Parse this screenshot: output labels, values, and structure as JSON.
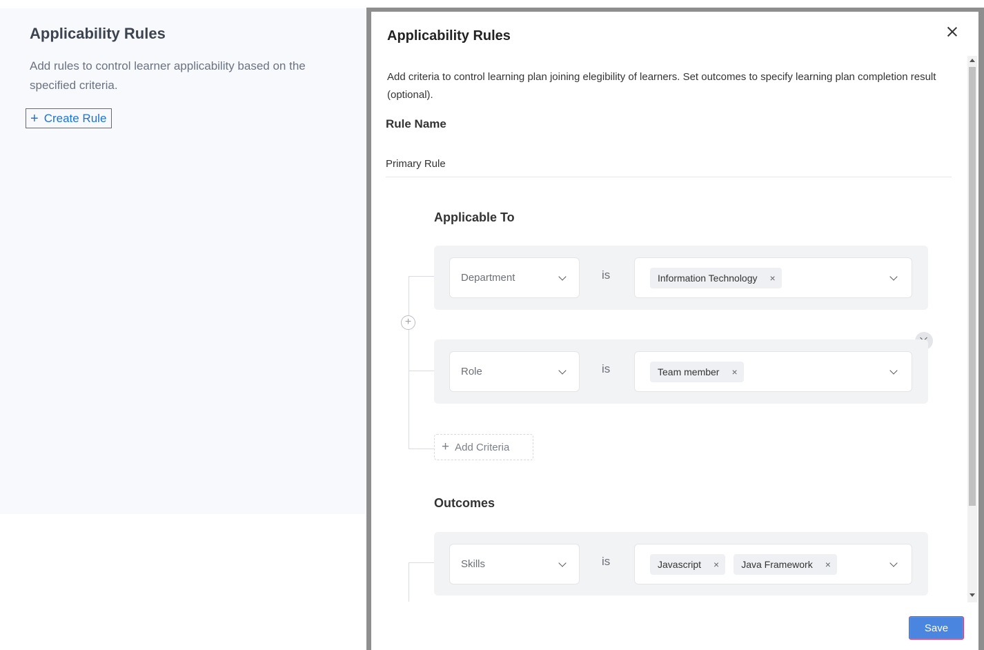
{
  "left_panel": {
    "title": "Applicability Rules",
    "description": "Add rules to control learner applicability based on the specified criteria.",
    "create_rule_label": "Create Rule"
  },
  "modal": {
    "title": "Applicability Rules",
    "description": "Add criteria to control learning plan joining elegibility of learners. Set outcomes to specify learning plan completion result (optional).",
    "rule_name_label": "Rule Name",
    "rule_name_value": "Primary Rule",
    "applicable_to": {
      "title": "Applicable To",
      "criteria": [
        {
          "field": "Department",
          "operator": "is",
          "values": [
            "Information Technology"
          ]
        },
        {
          "field": "Role",
          "operator": "is",
          "values": [
            "Team member"
          ]
        }
      ],
      "add_criteria_label": "Add Criteria"
    },
    "outcomes": {
      "title": "Outcomes",
      "criteria": [
        {
          "field": "Skills",
          "operator": "is",
          "values": [
            "Javascript",
            "Java Framework"
          ]
        }
      ]
    },
    "save_label": "Save"
  },
  "icons": {
    "tag_remove": "×",
    "plus": "+"
  },
  "colors": {
    "accent": "#1a73d9",
    "save_button": "#4a86e0",
    "highlight_border": "#d63a3a"
  }
}
